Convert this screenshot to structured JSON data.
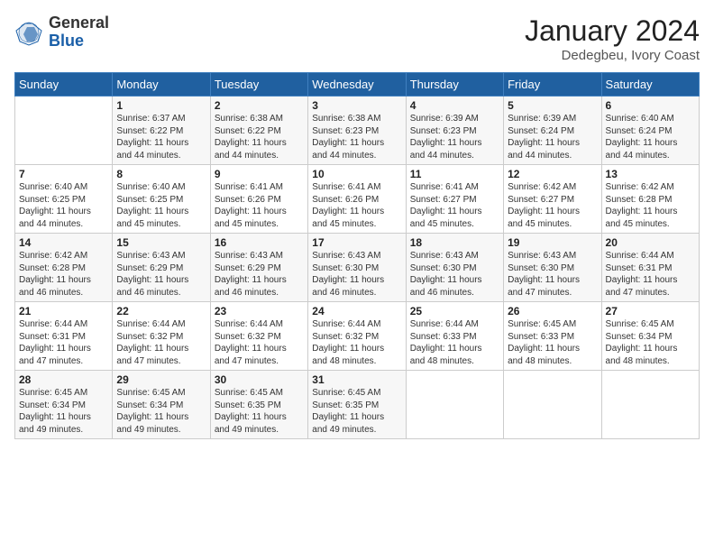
{
  "logo": {
    "general": "General",
    "blue": "Blue"
  },
  "title": "January 2024",
  "subtitle": "Dedegbeu, Ivory Coast",
  "days_header": [
    "Sunday",
    "Monday",
    "Tuesday",
    "Wednesday",
    "Thursday",
    "Friday",
    "Saturday"
  ],
  "weeks": [
    [
      {
        "day": "",
        "info": ""
      },
      {
        "day": "1",
        "info": "Sunrise: 6:37 AM\nSunset: 6:22 PM\nDaylight: 11 hours\nand 44 minutes."
      },
      {
        "day": "2",
        "info": "Sunrise: 6:38 AM\nSunset: 6:22 PM\nDaylight: 11 hours\nand 44 minutes."
      },
      {
        "day": "3",
        "info": "Sunrise: 6:38 AM\nSunset: 6:23 PM\nDaylight: 11 hours\nand 44 minutes."
      },
      {
        "day": "4",
        "info": "Sunrise: 6:39 AM\nSunset: 6:23 PM\nDaylight: 11 hours\nand 44 minutes."
      },
      {
        "day": "5",
        "info": "Sunrise: 6:39 AM\nSunset: 6:24 PM\nDaylight: 11 hours\nand 44 minutes."
      },
      {
        "day": "6",
        "info": "Sunrise: 6:40 AM\nSunset: 6:24 PM\nDaylight: 11 hours\nand 44 minutes."
      }
    ],
    [
      {
        "day": "7",
        "info": "Sunrise: 6:40 AM\nSunset: 6:25 PM\nDaylight: 11 hours\nand 44 minutes."
      },
      {
        "day": "8",
        "info": "Sunrise: 6:40 AM\nSunset: 6:25 PM\nDaylight: 11 hours\nand 45 minutes."
      },
      {
        "day": "9",
        "info": "Sunrise: 6:41 AM\nSunset: 6:26 PM\nDaylight: 11 hours\nand 45 minutes."
      },
      {
        "day": "10",
        "info": "Sunrise: 6:41 AM\nSunset: 6:26 PM\nDaylight: 11 hours\nand 45 minutes."
      },
      {
        "day": "11",
        "info": "Sunrise: 6:41 AM\nSunset: 6:27 PM\nDaylight: 11 hours\nand 45 minutes."
      },
      {
        "day": "12",
        "info": "Sunrise: 6:42 AM\nSunset: 6:27 PM\nDaylight: 11 hours\nand 45 minutes."
      },
      {
        "day": "13",
        "info": "Sunrise: 6:42 AM\nSunset: 6:28 PM\nDaylight: 11 hours\nand 45 minutes."
      }
    ],
    [
      {
        "day": "14",
        "info": "Sunrise: 6:42 AM\nSunset: 6:28 PM\nDaylight: 11 hours\nand 46 minutes."
      },
      {
        "day": "15",
        "info": "Sunrise: 6:43 AM\nSunset: 6:29 PM\nDaylight: 11 hours\nand 46 minutes."
      },
      {
        "day": "16",
        "info": "Sunrise: 6:43 AM\nSunset: 6:29 PM\nDaylight: 11 hours\nand 46 minutes."
      },
      {
        "day": "17",
        "info": "Sunrise: 6:43 AM\nSunset: 6:30 PM\nDaylight: 11 hours\nand 46 minutes."
      },
      {
        "day": "18",
        "info": "Sunrise: 6:43 AM\nSunset: 6:30 PM\nDaylight: 11 hours\nand 46 minutes."
      },
      {
        "day": "19",
        "info": "Sunrise: 6:43 AM\nSunset: 6:30 PM\nDaylight: 11 hours\nand 47 minutes."
      },
      {
        "day": "20",
        "info": "Sunrise: 6:44 AM\nSunset: 6:31 PM\nDaylight: 11 hours\nand 47 minutes."
      }
    ],
    [
      {
        "day": "21",
        "info": "Sunrise: 6:44 AM\nSunset: 6:31 PM\nDaylight: 11 hours\nand 47 minutes."
      },
      {
        "day": "22",
        "info": "Sunrise: 6:44 AM\nSunset: 6:32 PM\nDaylight: 11 hours\nand 47 minutes."
      },
      {
        "day": "23",
        "info": "Sunrise: 6:44 AM\nSunset: 6:32 PM\nDaylight: 11 hours\nand 47 minutes."
      },
      {
        "day": "24",
        "info": "Sunrise: 6:44 AM\nSunset: 6:32 PM\nDaylight: 11 hours\nand 48 minutes."
      },
      {
        "day": "25",
        "info": "Sunrise: 6:44 AM\nSunset: 6:33 PM\nDaylight: 11 hours\nand 48 minutes."
      },
      {
        "day": "26",
        "info": "Sunrise: 6:45 AM\nSunset: 6:33 PM\nDaylight: 11 hours\nand 48 minutes."
      },
      {
        "day": "27",
        "info": "Sunrise: 6:45 AM\nSunset: 6:34 PM\nDaylight: 11 hours\nand 48 minutes."
      }
    ],
    [
      {
        "day": "28",
        "info": "Sunrise: 6:45 AM\nSunset: 6:34 PM\nDaylight: 11 hours\nand 49 minutes."
      },
      {
        "day": "29",
        "info": "Sunrise: 6:45 AM\nSunset: 6:34 PM\nDaylight: 11 hours\nand 49 minutes."
      },
      {
        "day": "30",
        "info": "Sunrise: 6:45 AM\nSunset: 6:35 PM\nDaylight: 11 hours\nand 49 minutes."
      },
      {
        "day": "31",
        "info": "Sunrise: 6:45 AM\nSunset: 6:35 PM\nDaylight: 11 hours\nand 49 minutes."
      },
      {
        "day": "",
        "info": ""
      },
      {
        "day": "",
        "info": ""
      },
      {
        "day": "",
        "info": ""
      }
    ]
  ]
}
